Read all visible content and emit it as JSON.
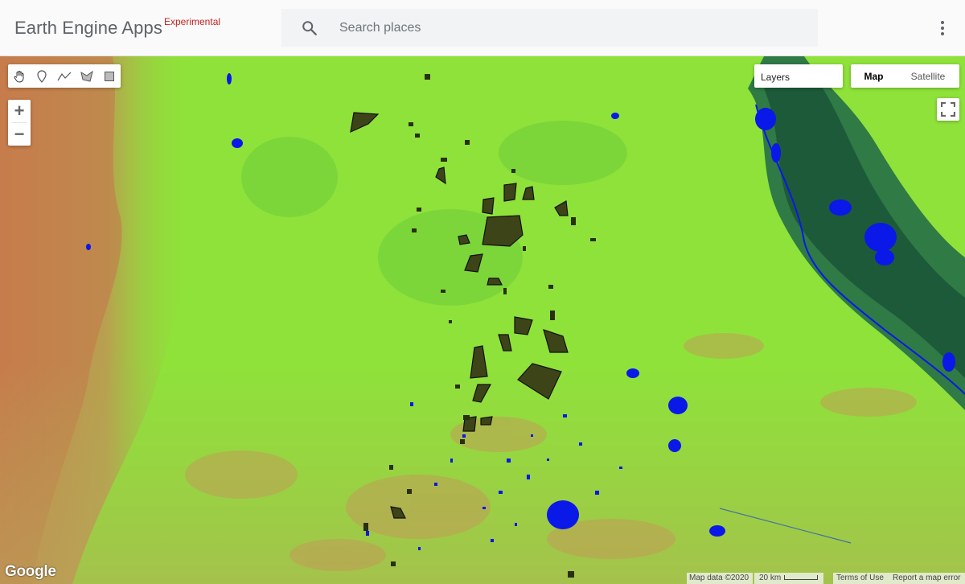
{
  "header": {
    "brand": "Earth Engine Apps",
    "brand_tag": "Experimental",
    "search_placeholder": "Search places",
    "search_icon": "search-icon",
    "menu_icon": "more-vert-icon"
  },
  "map": {
    "toolbar": [
      {
        "name": "pan-hand-icon"
      },
      {
        "name": "add-marker-icon"
      },
      {
        "name": "draw-line-icon"
      },
      {
        "name": "draw-shape-icon"
      },
      {
        "name": "draw-rectangle-icon"
      }
    ],
    "zoom_in": "+",
    "zoom_out": "−",
    "layers_label": "Layers",
    "map_type": {
      "map": "Map",
      "satellite": "Satellite",
      "selected": "Map"
    },
    "fullscreen_icon": "fullscreen-icon",
    "logo": "Google",
    "attribution": {
      "data": "Map data ©2020",
      "scale": "20 km",
      "terms": "Terms of Use",
      "report": "Report a map error"
    },
    "colors": {
      "vegetation": "#8fe23a",
      "bare_soil": "#d28a55",
      "water": "#0a18e8",
      "river": "#1d5a3a",
      "polygons": "#3d4418"
    }
  }
}
